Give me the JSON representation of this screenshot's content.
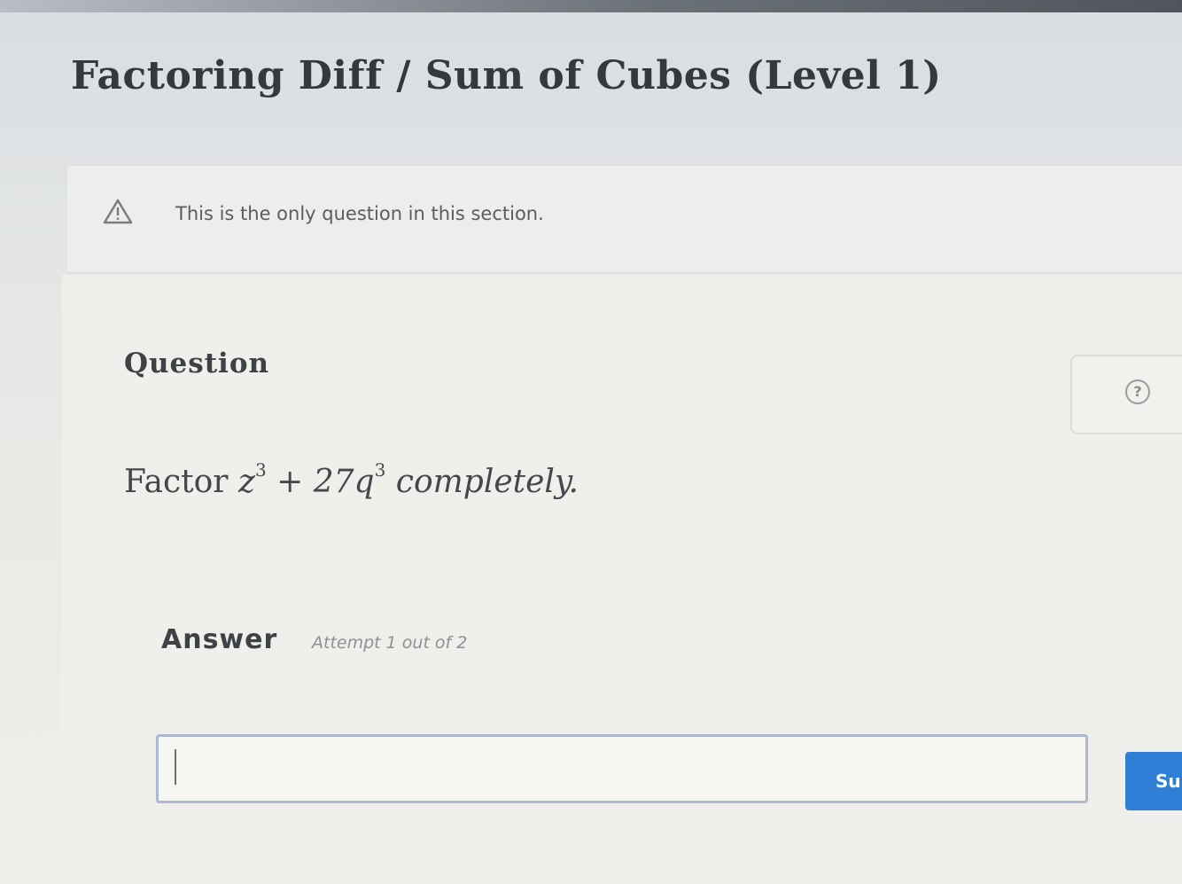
{
  "page": {
    "title": "Factoring Diff / Sum of Cubes (Level 1)"
  },
  "notice": {
    "icon": "warning-icon",
    "text": "This is the only question in this section."
  },
  "question": {
    "heading": "Question",
    "prefix": "Factor",
    "expr_a": "z",
    "exp_a": "3",
    "plus": "+",
    "expr_b": "27q",
    "exp_b": "3",
    "suffix": "completely.",
    "help_icon": "help-icon",
    "help_glyph": "?"
  },
  "answer": {
    "label": "Answer",
    "attempt": "Attempt 1 out of 2",
    "input_value": "",
    "submit_label": "Sub"
  },
  "colors": {
    "submit": "#2f7fd6",
    "input_border": "#aeb8d0",
    "warning": "#7a7c7e"
  }
}
